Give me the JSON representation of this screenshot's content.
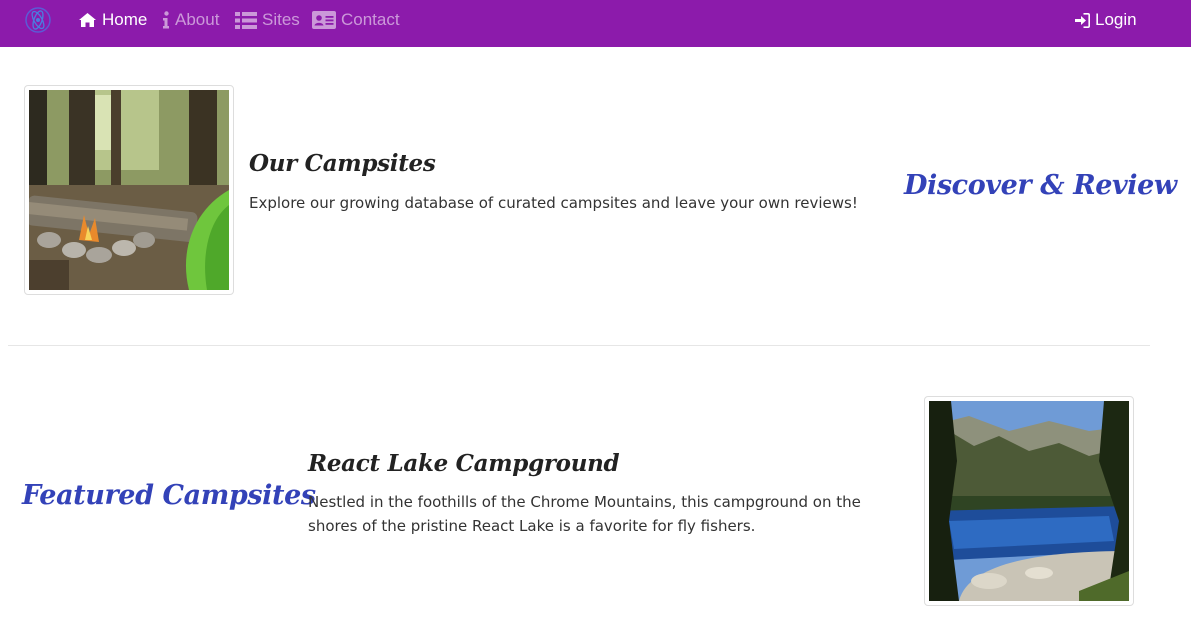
{
  "navbar": {
    "brand_color": "#8c1bab",
    "logo_icon": "reactjs-logo-icon",
    "items": [
      {
        "label": "Home",
        "icon": "home-icon",
        "active": true
      },
      {
        "label": "About",
        "icon": "info-icon",
        "active": false
      },
      {
        "label": "Sites",
        "icon": "list-icon",
        "active": false
      },
      {
        "label": "Contact",
        "icon": "id-card-icon",
        "active": false
      }
    ],
    "login": {
      "label": "Login",
      "icon": "sign-in-icon"
    }
  },
  "intro": {
    "title": "Our Campsites",
    "text": "Explore our growing database of curated campsites and leave your own reviews!",
    "accent": "Discover & Review",
    "image": "campfire-and-tent-photo"
  },
  "featured": {
    "accent": "Featured Campsites",
    "title": "React Lake Campground",
    "text": "Nestled in the foothills of the Chrome Mountains, this campground on the shores of the pristine React Lake is a favorite for fly fishers.",
    "image": "mountain-lake-photo"
  },
  "colors": {
    "accent": "#3342b8"
  }
}
